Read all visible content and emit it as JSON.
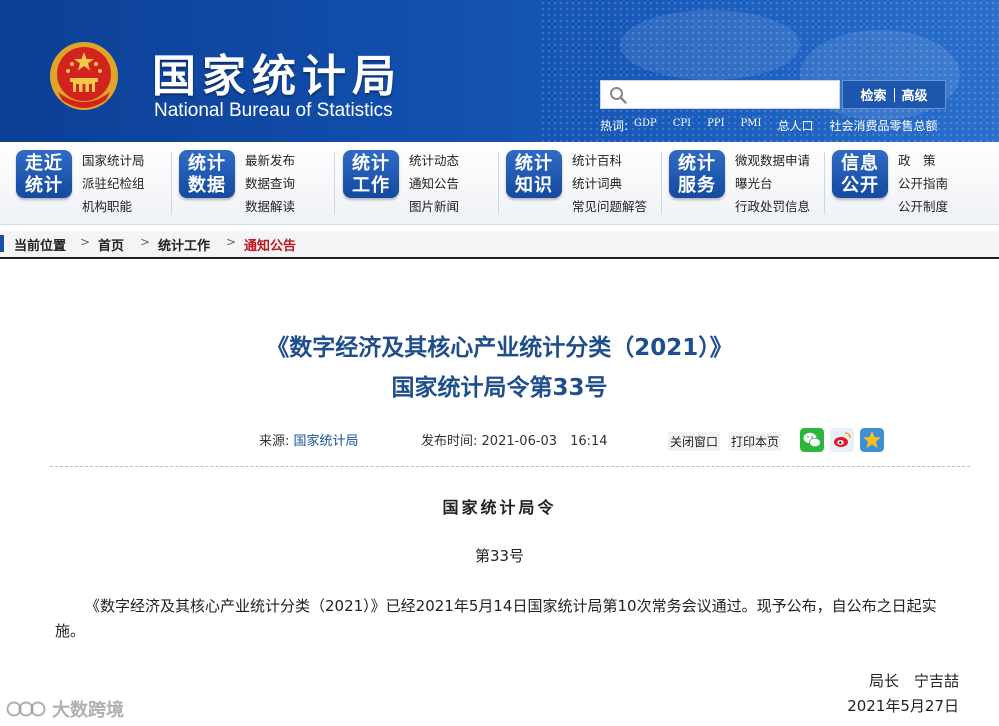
{
  "header": {
    "title_cn": "国家统计局",
    "title_en": "National Bureau of Statistics",
    "search": {
      "placeholder": "",
      "search_label": "检索",
      "advanced_label": "高级"
    },
    "hot_label": "热词:",
    "hot_words": [
      "GDP",
      "CPI",
      "PPI",
      "PMI",
      "总人口",
      "社会消费品零售总额"
    ]
  },
  "nav": [
    {
      "badge": [
        "走近",
        "统计"
      ],
      "links": [
        "国家统计局",
        "派驻纪检组",
        "机构职能"
      ]
    },
    {
      "badge": [
        "统计",
        "数据"
      ],
      "links": [
        "最新发布",
        "数据查询",
        "数据解读"
      ]
    },
    {
      "badge": [
        "统计",
        "工作"
      ],
      "links": [
        "统计动态",
        "通知公告",
        "图片新闻"
      ]
    },
    {
      "badge": [
        "统计",
        "知识"
      ],
      "links": [
        "统计百科",
        "统计词典",
        "常见问题解答"
      ]
    },
    {
      "badge": [
        "统计",
        "服务"
      ],
      "links": [
        "微观数据申请",
        "曝光台",
        "行政处罚信息"
      ]
    },
    {
      "badge": [
        "信息",
        "公开"
      ],
      "links": [
        "政　策",
        "公开指南",
        "公开制度"
      ]
    }
  ],
  "breadcrumb": {
    "label": "当前位置",
    "items": [
      "首页",
      "统计工作",
      "通知公告"
    ],
    "active_color": "#c0181f"
  },
  "article": {
    "title_line1": "《数字经济及其核心产业统计分类（2021）》",
    "title_line2": "国家统计局令第33号",
    "source_label": "来源:",
    "source_value": "国家统计局",
    "date_label": "发布时间:",
    "date_value": "2021-06-03　16:14",
    "close_label": "关闭窗口",
    "print_label": "打印本页",
    "share_icons": [
      "wechat-icon",
      "weibo-icon",
      "qzone-icon"
    ],
    "order_heading": "国家统计局令",
    "order_number": "第33号",
    "body": "《数字经济及其核心产业统计分类（2021）》已经2021年5月14日国家统计局第10次常务会议通过。现予公布，自公布之日起实施。",
    "signature_title": "局长　宁吉喆",
    "signature_date": "2021年5月27日"
  },
  "watermark": {
    "text": "大数跨境"
  },
  "colors": {
    "header_blue": "#1250ae",
    "title_blue": "#1f4e8c",
    "accent_red": "#c0181f"
  }
}
